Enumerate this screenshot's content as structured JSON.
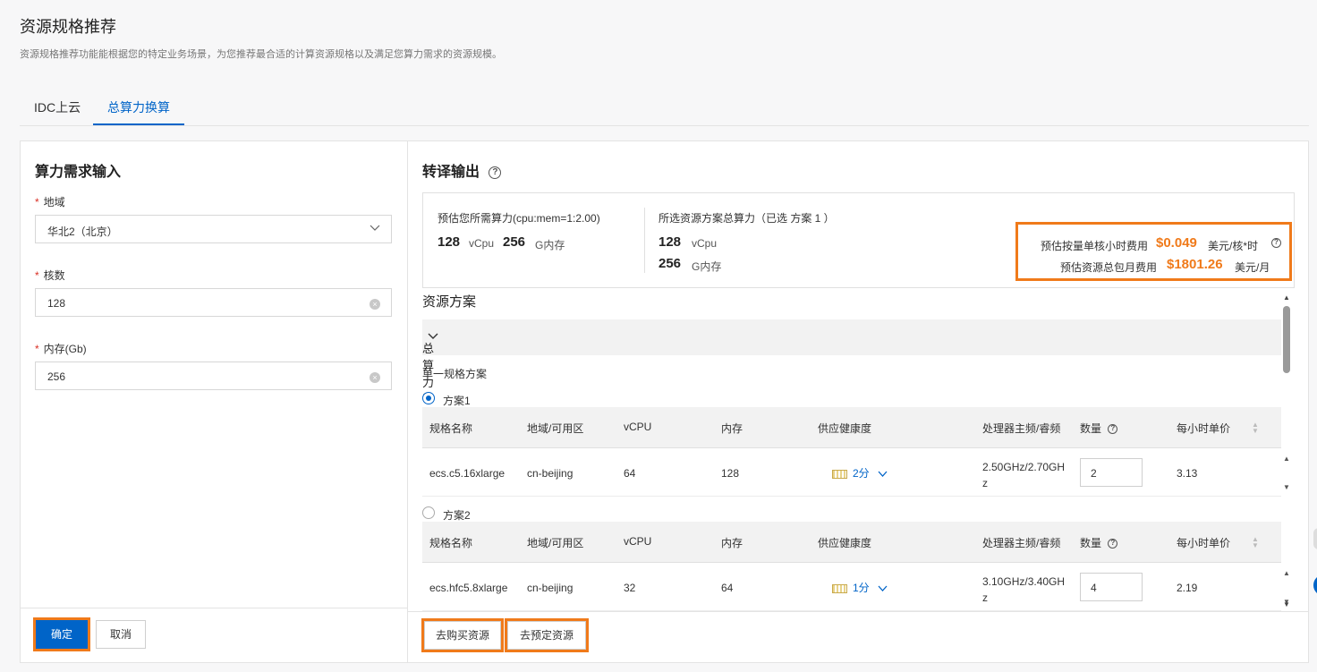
{
  "header": {
    "title": "资源规格推荐",
    "description": "资源规格推荐功能能根据您的特定业务场景，为您推荐最合适的计算资源规格以及满足您算力需求的资源规模。"
  },
  "tabs": [
    {
      "label": "IDC上云",
      "active": false
    },
    {
      "label": "总算力换算",
      "active": true
    }
  ],
  "input_panel": {
    "title": "算力需求输入",
    "region": {
      "label": "地域",
      "value": "华北2（北京）"
    },
    "cores": {
      "label": "核数",
      "value": "128"
    },
    "memory": {
      "label": "内存(Gb)",
      "value": "256"
    },
    "confirm_label": "确定",
    "cancel_label": "取消"
  },
  "output_panel": {
    "title": "转译输出",
    "required": {
      "label": "预估您所需算力(cpu:mem=1:2.00)",
      "vcpu": "128",
      "vcpu_unit": "vCpu",
      "mem": "256",
      "mem_unit": "G内存"
    },
    "selected": {
      "label": "所选资源方案总算力（已选 方案 1 ）",
      "vcpu": "128",
      "vcpu_unit": "vCpu",
      "mem": "256",
      "mem_unit": "G内存"
    },
    "cost": {
      "hourly_label": "预估按量单核小时费用",
      "hourly_value": "$0.049",
      "hourly_unit": "美元/核*时",
      "monthly_label": "预估资源总包月费用",
      "monthly_value": "$1801.26",
      "monthly_unit": "美元/月"
    },
    "section_title": "资源方案",
    "group_label": "总算力1",
    "subsection_title": "单一规格方案",
    "columns": [
      "规格名称",
      "地域/可用区",
      "vCPU",
      "内存",
      "供应健康度",
      "处理器主频/睿频",
      "数量",
      "每小时单价"
    ],
    "plans": [
      {
        "name": "方案1",
        "selected": true,
        "row": {
          "spec": "ecs.c5.16xlarge",
          "zone": "cn-beijing",
          "vcpu": "64",
          "mem": "128",
          "health": "2分",
          "freq": "2.50GHz/2.70GH z",
          "qty": "2",
          "price": "3.13"
        }
      },
      {
        "name": "方案2",
        "selected": false,
        "row": {
          "spec": "ecs.hfc5.8xlarge",
          "zone": "cn-beijing",
          "vcpu": "32",
          "mem": "64",
          "health": "1分",
          "freq": "3.10GHz/3.40GH z",
          "qty": "4",
          "price": "2.19"
        }
      }
    ],
    "buy_label": "去购买资源",
    "reserve_label": "去预定资源"
  },
  "colors": {
    "primary": "#0064c8",
    "highlight": "#f07a1a",
    "required": "#d93026"
  }
}
